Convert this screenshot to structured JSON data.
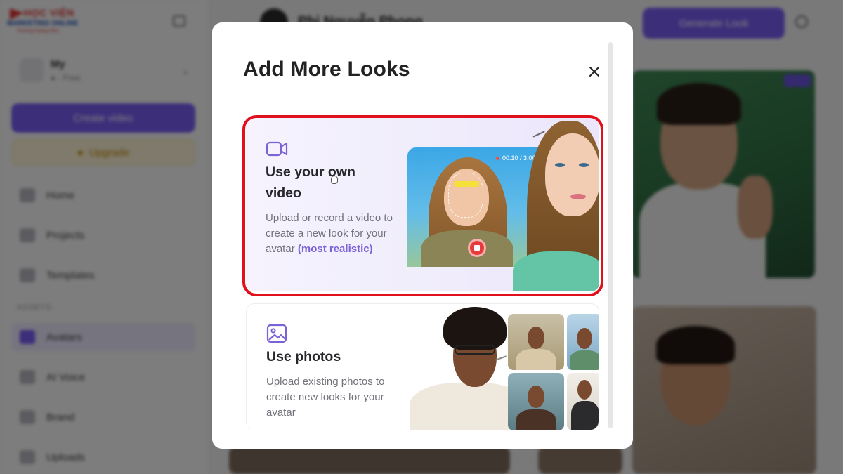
{
  "logo": {
    "line1": "HỌC VIỆN",
    "line2": "MARKETING ONLINE",
    "line3": "Trường Giang Hữu"
  },
  "sidebar": {
    "workspace_name": "My",
    "workspace_sub": "● · Free",
    "create_label": "Create video",
    "upgrade_label": "Upgrade",
    "nav_items": [
      {
        "label": "Home"
      },
      {
        "label": "Projects"
      },
      {
        "label": "Templates"
      }
    ],
    "section_label": "ASSETS",
    "asset_items": [
      {
        "label": "Avatars"
      },
      {
        "label": "AI Voice"
      },
      {
        "label": "Brand"
      },
      {
        "label": "Uploads"
      }
    ]
  },
  "topbar": {
    "avatar_name": "Phi Nguyễn Phong",
    "generate_label": "Generate Look"
  },
  "modal": {
    "title": "Add More Looks",
    "close_icon": "close-icon",
    "options": [
      {
        "icon": "video-camera-icon",
        "title": "Use your own video",
        "description": "Upload or record a video to create a new look for your avatar",
        "accent": "(most realistic)",
        "timer": "00:10 / 3:00",
        "highlighted": true
      },
      {
        "icon": "image-icon",
        "title": "Use photos",
        "description": "Upload existing photos to create new looks for your avatar",
        "accent": "",
        "highlighted": false
      }
    ]
  },
  "colors": {
    "accent": "#7b5cf5",
    "highlight_border": "#e0111c",
    "accent_text": "#7b62d6"
  }
}
